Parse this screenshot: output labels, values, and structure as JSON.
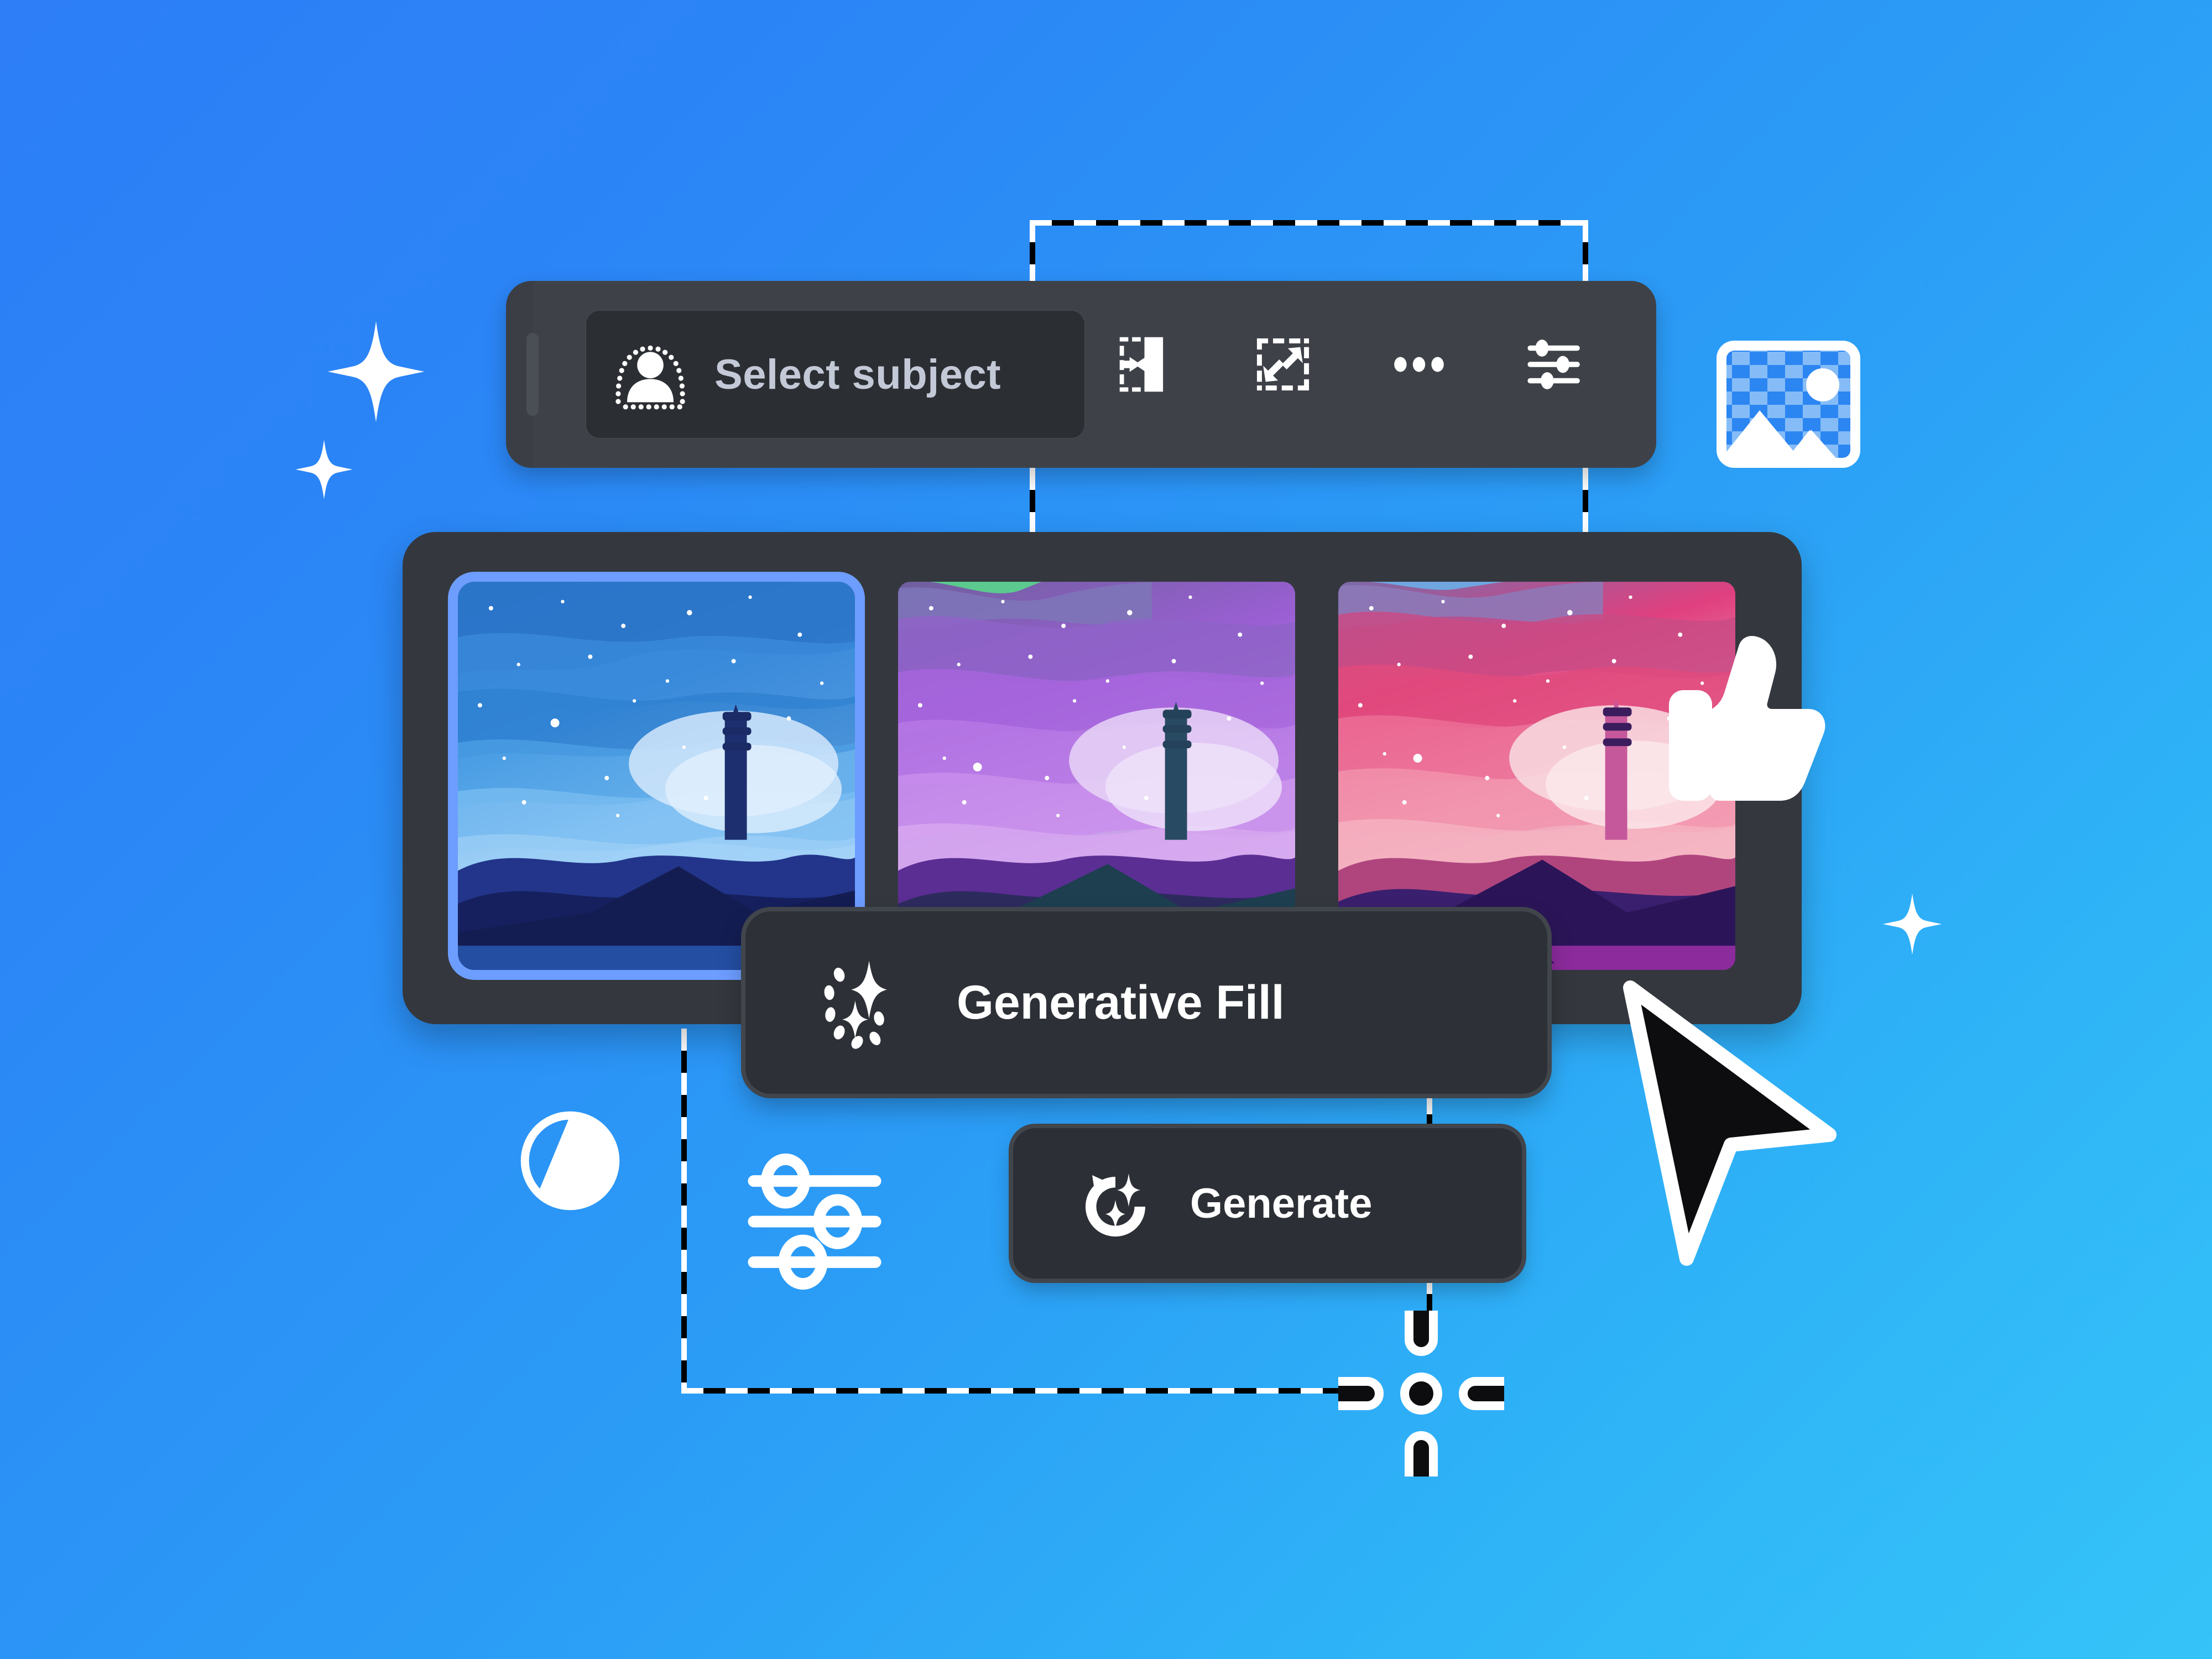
{
  "theme": {
    "bg_gradient_from": "#2d7ef7",
    "bg_gradient_to": "#35c3f8",
    "panel_bg": "#34383e",
    "toolbar_bg": "#3e4248",
    "pill_bg": "#2d3036",
    "selected_thumb_border": "#6d9dff",
    "label_color": "#c3c9d6",
    "accent_white": "#ffffff"
  },
  "toolbar": {
    "name": "selection-toolbar",
    "select_subject_label": "Select subject",
    "select_subject_icon": "person-selection-icon",
    "grip_icon": "drag-grip-icon",
    "icons": [
      {
        "name": "select-and-mask-icon",
        "label": "Select and Mask"
      },
      {
        "name": "transform-selection-icon",
        "label": "Transform Selection"
      },
      {
        "name": "more-options-icon",
        "label": "More options"
      },
      {
        "name": "adjustment-sliders-icon",
        "label": "Settings"
      }
    ]
  },
  "gallery": {
    "name": "variation-gallery",
    "thumbnails": [
      {
        "name": "variation-thumbnail-blue",
        "alt": "Lighthouse at night, blue aurora sky",
        "selected": true,
        "palette": "blue"
      },
      {
        "name": "variation-thumbnail-purple",
        "alt": "Lighthouse at night, purple aurora sky",
        "selected": false,
        "palette": "purple"
      },
      {
        "name": "variation-thumbnail-pink",
        "alt": "Lighthouse at night, pink sunset sky",
        "selected": false,
        "palette": "pink"
      }
    ]
  },
  "generative_fill": {
    "name": "generative-fill-pill",
    "label": "Generative Fill",
    "icon": "sparkle-circle-icon"
  },
  "generate": {
    "name": "generate-button",
    "label": "Generate",
    "icon": "refresh-sparkle-icon"
  },
  "decorations": {
    "image_placeholder_icon": "image-checkerboard-icon",
    "contrast_icon": "contrast-circle-icon",
    "sliders_icon": "sliders-icon",
    "thumbs_up_icon": "thumbs-up-icon",
    "cursor_icon": "arrow-cursor-icon",
    "crosshair_icon": "precision-crosshair-icon",
    "sparkle_large_icon": "sparkle-icon",
    "sparkle_medium_icon": "sparkle-icon",
    "sparkle_small_icon": "sparkle-icon"
  }
}
